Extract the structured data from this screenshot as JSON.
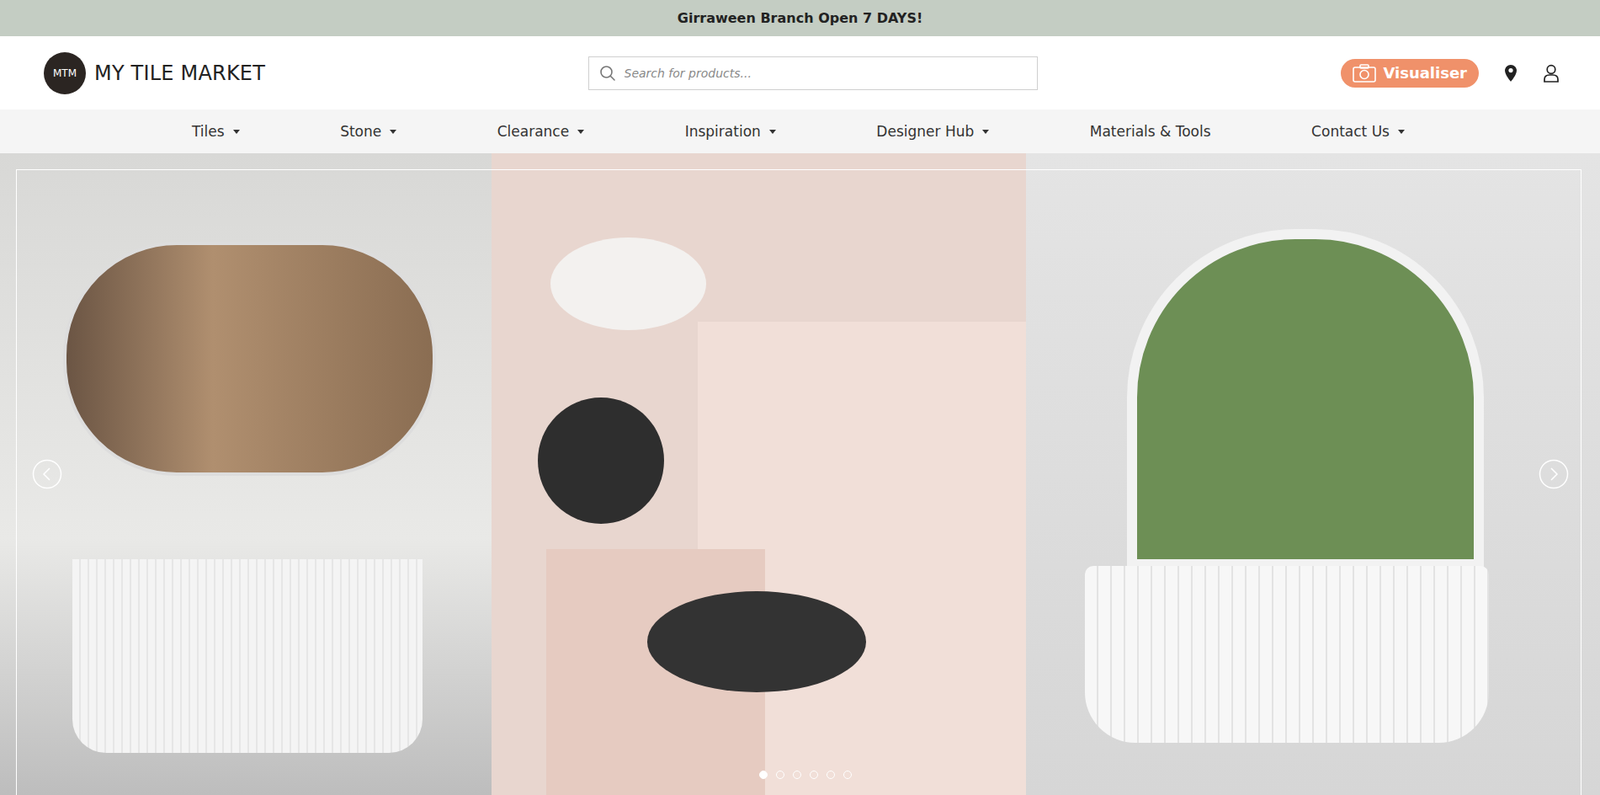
{
  "announcement": "Girraween Branch Open 7 DAYS!",
  "logo": {
    "badge": "MTM",
    "name": "MY TILE MARKET"
  },
  "search": {
    "placeholder": "Search for products..."
  },
  "visualiser": {
    "label": "Visualiser"
  },
  "nav": [
    {
      "label": "Tiles",
      "dropdown": true
    },
    {
      "label": "Stone",
      "dropdown": true
    },
    {
      "label": "Clearance",
      "dropdown": true
    },
    {
      "label": "Inspiration",
      "dropdown": true
    },
    {
      "label": "Designer Hub",
      "dropdown": true
    },
    {
      "label": "Materials & Tools",
      "dropdown": false
    },
    {
      "label": "Contact Us",
      "dropdown": true
    }
  ],
  "carousel": {
    "slides": [
      {
        "selected": true
      },
      {
        "selected": false
      },
      {
        "selected": false
      },
      {
        "selected": false
      },
      {
        "selected": false
      },
      {
        "selected": false
      }
    ]
  }
}
